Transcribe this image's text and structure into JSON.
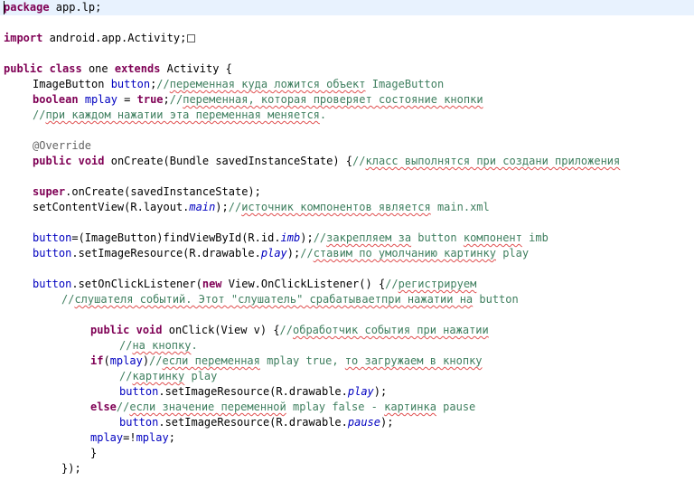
{
  "editor": {
    "lines": [
      {
        "indent": 0,
        "segments": [
          {
            "t": "package",
            "c": "kw"
          },
          {
            "t": " app.lp;"
          }
        ],
        "current": true
      },
      {
        "indent": 0,
        "segments": []
      },
      {
        "indent": 0,
        "segments": [
          {
            "t": "import",
            "c": "kw"
          },
          {
            "t": " android.app.Activity;"
          }
        ],
        "fold": true
      },
      {
        "indent": 0,
        "segments": []
      },
      {
        "indent": 0,
        "segments": [
          {
            "t": "public",
            "c": "kw"
          },
          {
            "t": " "
          },
          {
            "t": "class",
            "c": "kw"
          },
          {
            "t": " one "
          },
          {
            "t": "extends",
            "c": "kw"
          },
          {
            "t": " Activity {"
          }
        ]
      },
      {
        "indent": 4,
        "segments": [
          {
            "t": "ImageButton "
          },
          {
            "t": "button",
            "c": "fld"
          },
          {
            "t": ";"
          },
          {
            "t": "//",
            "c": "cm"
          },
          {
            "t": "переменная куда ложится объект",
            "c": "cm cm-ru"
          },
          {
            "t": " ImageButton",
            "c": "cm"
          }
        ]
      },
      {
        "indent": 4,
        "segments": [
          {
            "t": "boolean",
            "c": "kw"
          },
          {
            "t": " "
          },
          {
            "t": "mplay",
            "c": "fld"
          },
          {
            "t": " = "
          },
          {
            "t": "true",
            "c": "kw"
          },
          {
            "t": ";"
          },
          {
            "t": "//",
            "c": "cm"
          },
          {
            "t": "переменная, которая проверяет состояние кнопки",
            "c": "cm cm-ru"
          }
        ]
      },
      {
        "indent": 4,
        "segments": [
          {
            "t": "//",
            "c": "cm"
          },
          {
            "t": "при каждом нажатии эта переменная меняется",
            "c": "cm cm-ru"
          },
          {
            "t": ".",
            "c": "cm"
          }
        ]
      },
      {
        "indent": 0,
        "segments": []
      },
      {
        "indent": 4,
        "segments": [
          {
            "t": "@Override",
            "c": "ann"
          }
        ]
      },
      {
        "indent": 4,
        "segments": [
          {
            "t": "public",
            "c": "kw"
          },
          {
            "t": " "
          },
          {
            "t": "void",
            "c": "kw"
          },
          {
            "t": " onCreate(Bundle savedInstanceState) {"
          },
          {
            "t": "//",
            "c": "cm"
          },
          {
            "t": "класс выполнятся при создани приложения",
            "c": "cm cm-ru"
          }
        ]
      },
      {
        "indent": 0,
        "segments": []
      },
      {
        "indent": 4,
        "segments": [
          {
            "t": "super",
            "c": "kw"
          },
          {
            "t": ".onCreate(savedInstanceState);"
          }
        ]
      },
      {
        "indent": 4,
        "segments": [
          {
            "t": "setContentView(R.layout."
          },
          {
            "t": "main",
            "c": "fld-it"
          },
          {
            "t": ");"
          },
          {
            "t": "//",
            "c": "cm"
          },
          {
            "t": "источник компонентов является",
            "c": "cm cm-ru"
          },
          {
            "t": " main.xml",
            "c": "cm"
          }
        ]
      },
      {
        "indent": 0,
        "segments": []
      },
      {
        "indent": 4,
        "segments": [
          {
            "t": "button",
            "c": "fld"
          },
          {
            "t": "=(ImageButton)findViewById(R.id."
          },
          {
            "t": "imb",
            "c": "fld-it"
          },
          {
            "t": ");"
          },
          {
            "t": "//",
            "c": "cm"
          },
          {
            "t": "закрепляем за",
            "c": "cm cm-ru"
          },
          {
            "t": " button ",
            "c": "cm"
          },
          {
            "t": "компонент",
            "c": "cm cm-ru"
          },
          {
            "t": " imb",
            "c": "cm"
          }
        ]
      },
      {
        "indent": 4,
        "segments": [
          {
            "t": "button",
            "c": "fld"
          },
          {
            "t": ".setImageResource(R.drawable."
          },
          {
            "t": "play",
            "c": "fld-it"
          },
          {
            "t": ");"
          },
          {
            "t": "//",
            "c": "cm"
          },
          {
            "t": "ставим по умолчанию картинку",
            "c": "cm cm-ru"
          },
          {
            "t": " play",
            "c": "cm"
          }
        ]
      },
      {
        "indent": 0,
        "segments": []
      },
      {
        "indent": 4,
        "segments": [
          {
            "t": "button",
            "c": "fld"
          },
          {
            "t": ".setOnClickListener("
          },
          {
            "t": "new",
            "c": "kw"
          },
          {
            "t": " View.OnClickListener() {"
          },
          {
            "t": "//",
            "c": "cm"
          },
          {
            "t": "регистрируем",
            "c": "cm cm-ru"
          }
        ]
      },
      {
        "indent": 8,
        "segments": [
          {
            "t": "//",
            "c": "cm"
          },
          {
            "t": "слушателя событий. Этот \"слушатель\" срабатываетпри нажатии на",
            "c": "cm cm-ru"
          },
          {
            "t": " button",
            "c": "cm"
          }
        ]
      },
      {
        "indent": 0,
        "segments": []
      },
      {
        "indent": 12,
        "segments": [
          {
            "t": "public",
            "c": "kw"
          },
          {
            "t": " "
          },
          {
            "t": "void",
            "c": "kw"
          },
          {
            "t": " onClick(View v) {"
          },
          {
            "t": "//",
            "c": "cm"
          },
          {
            "t": "обработчик события при нажатии",
            "c": "cm cm-ru"
          }
        ]
      },
      {
        "indent": 16,
        "segments": [
          {
            "t": "//",
            "c": "cm"
          },
          {
            "t": "на кнопку",
            "c": "cm cm-ru"
          },
          {
            "t": ".",
            "c": "cm"
          }
        ]
      },
      {
        "indent": 12,
        "segments": [
          {
            "t": "if",
            "c": "kw"
          },
          {
            "t": "("
          },
          {
            "t": "mplay",
            "c": "fld"
          },
          {
            "t": ")"
          },
          {
            "t": "//",
            "c": "cm"
          },
          {
            "t": "если переменная",
            "c": "cm cm-ru"
          },
          {
            "t": " mplay true, ",
            "c": "cm"
          },
          {
            "t": "то загружаем в кнопку",
            "c": "cm cm-ru"
          }
        ]
      },
      {
        "indent": 16,
        "segments": [
          {
            "t": "//",
            "c": "cm"
          },
          {
            "t": "картинку",
            "c": "cm cm-ru"
          },
          {
            "t": " play",
            "c": "cm"
          }
        ]
      },
      {
        "indent": 16,
        "segments": [
          {
            "t": "button",
            "c": "fld"
          },
          {
            "t": ".setImageResource(R.drawable."
          },
          {
            "t": "play",
            "c": "fld-it"
          },
          {
            "t": ");"
          }
        ]
      },
      {
        "indent": 12,
        "segments": [
          {
            "t": "else",
            "c": "kw"
          },
          {
            "t": "//",
            "c": "cm"
          },
          {
            "t": "если значение переменной",
            "c": "cm cm-ru"
          },
          {
            "t": " mplay false - ",
            "c": "cm"
          },
          {
            "t": "картинка",
            "c": "cm cm-ru"
          },
          {
            "t": " pause",
            "c": "cm"
          }
        ]
      },
      {
        "indent": 16,
        "segments": [
          {
            "t": "button",
            "c": "fld"
          },
          {
            "t": ".setImageResource(R.drawable."
          },
          {
            "t": "pause",
            "c": "fld-it"
          },
          {
            "t": ");"
          }
        ]
      },
      {
        "indent": 12,
        "segments": [
          {
            "t": "mplay",
            "c": "fld"
          },
          {
            "t": "=!"
          },
          {
            "t": "mplay",
            "c": "fld"
          },
          {
            "t": ";"
          }
        ]
      },
      {
        "indent": 12,
        "segments": [
          {
            "t": "}"
          }
        ]
      },
      {
        "indent": 8,
        "segments": [
          {
            "t": "});"
          }
        ]
      }
    ]
  }
}
